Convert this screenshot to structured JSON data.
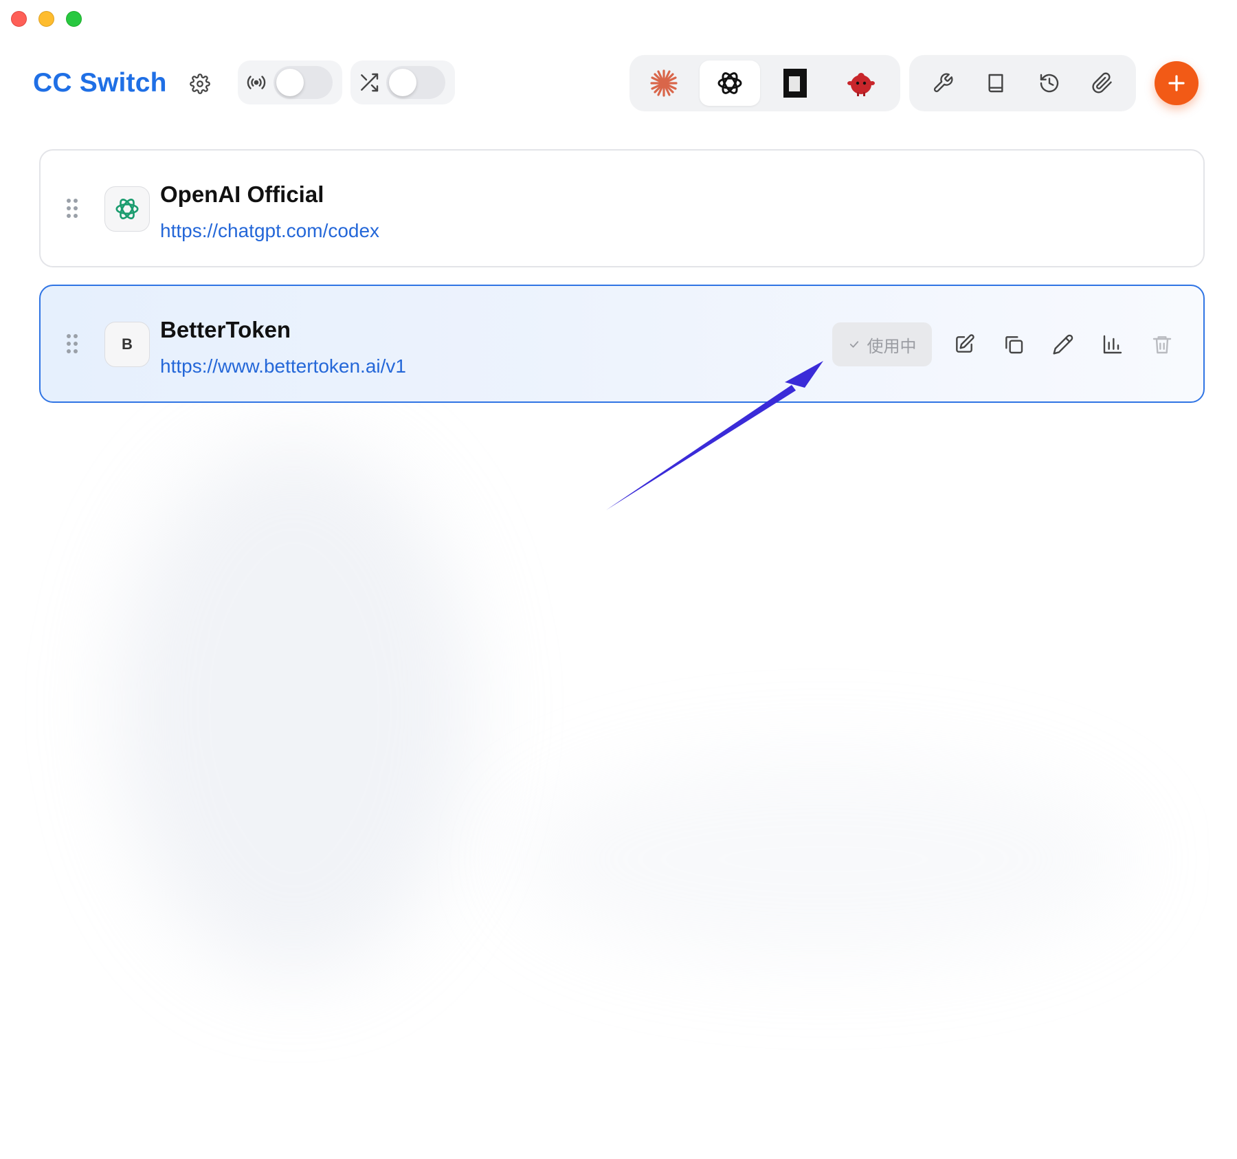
{
  "app": {
    "title": "CC Switch"
  },
  "header": {
    "settings_icon": "gear-icon",
    "toggles": [
      {
        "icon": "broadcast-icon",
        "state": "off"
      },
      {
        "icon": "shuffle-icon",
        "state": "off"
      }
    ],
    "app_tabs": [
      {
        "icon": "claude-icon",
        "active": false
      },
      {
        "icon": "openai-icon",
        "active": true
      },
      {
        "icon": "terminal-block-icon",
        "active": false
      },
      {
        "icon": "red-mascot-icon",
        "active": false
      }
    ],
    "tools": [
      "wrench-icon",
      "book-icon",
      "history-icon",
      "paperclip-icon"
    ],
    "add_icon": "plus-icon"
  },
  "providers": [
    {
      "name": "OpenAI Official",
      "url": "https://chatgpt.com/codex",
      "avatar": "openai-icon",
      "active": false
    },
    {
      "name": "BetterToken",
      "url": "https://www.bettertoken.ai/v1",
      "avatar_letter": "B",
      "active": true,
      "status_label": "使用中"
    }
  ],
  "colors": {
    "brand_blue": "#1f6fe5",
    "link_blue": "#2467d8",
    "add_orange": "#f25a16",
    "active_border": "#2f74e4",
    "annotation_arrow": "#3a2bd8"
  }
}
